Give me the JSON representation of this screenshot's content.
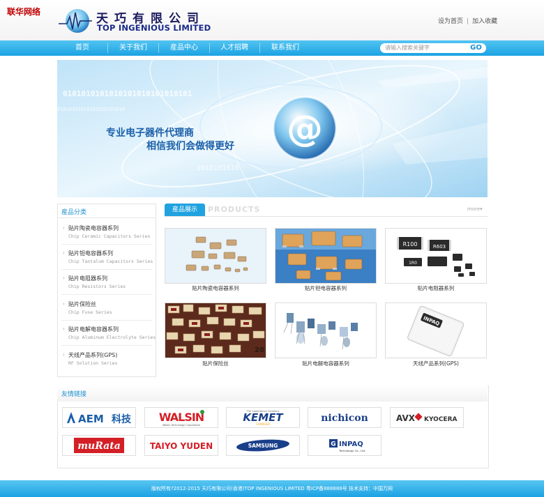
{
  "watermark": "联华网络",
  "brand": {
    "cn": "天巧有限公司",
    "en": "TOP INGENIOUS LIMITED"
  },
  "top_links": {
    "home": "设为首页",
    "separator": "|",
    "favorite": "加入收藏"
  },
  "nav": {
    "items": [
      {
        "label": "首页"
      },
      {
        "label": "关于我们"
      },
      {
        "label": "産品中心"
      },
      {
        "label": "人才招聘"
      },
      {
        "label": "联系我们"
      }
    ],
    "search_placeholder": "请输入搜索关键字",
    "search_button": "GO"
  },
  "banner": {
    "line1": "专业电子器件代理商",
    "line2": "相信我们会做得更好",
    "binary_top": "0101010101010101010101010101",
    "binary_mid": "01010101010101010101010",
    "binary_small": "1010101010",
    "at_symbol": "@"
  },
  "sidebar": {
    "title": "産品分类",
    "categories": [
      {
        "cn": "贴片陶瓷电容器系列",
        "en": "Chip Ceramic Capacitors Series"
      },
      {
        "cn": "贴片钽电容器系列",
        "en": "Chip Tantalum Capacitors Series"
      },
      {
        "cn": "贴片电阻器系列",
        "en": "Chip Resistors Series"
      },
      {
        "cn": "贴片保险丝",
        "en": "Chip Fuse Series"
      },
      {
        "cn": "贴片电解电容器系列",
        "en": "Chip Aluminum Electrolyte Series"
      },
      {
        "cn": "天线产品系列(GPS)",
        "en": "RF Solution Series"
      }
    ]
  },
  "products": {
    "tab": "産品展示",
    "tab_en": "PRODUCTS",
    "more": "more",
    "items": [
      {
        "caption": "贴片陶瓷电容器系列"
      },
      {
        "caption": "贴片钽电容器系列"
      },
      {
        "caption": "贴片电阻器系列"
      },
      {
        "caption": "贴片保险丝"
      },
      {
        "caption": "贴片电解电容器系列"
      },
      {
        "caption": "天线产品系列(GPS)"
      }
    ]
  },
  "friend_links": {
    "title": "友情链接",
    "brands": [
      {
        "name": "AEM",
        "suffix": "科技"
      },
      {
        "name": "WALSIN",
        "sub": "Walsin Technology Corporation"
      },
      {
        "name": "KEMET",
        "top": "The Capacitance Company",
        "sub": "CHARGED"
      },
      {
        "name": "nichicon"
      },
      {
        "name": "AVX",
        "suffix": "KYOCERA"
      },
      {
        "name": "muRata"
      },
      {
        "name": "TAIYO YUDEN"
      },
      {
        "name": "SAMSUNG"
      },
      {
        "name": "INPAQ",
        "sub": "Technology Co., Ltd."
      }
    ]
  },
  "component_labels": {
    "r100": "R100",
    "r603": "R603",
    "n1": "1R0",
    "inpaq": "INPAQ",
    "fuse": "20"
  },
  "footer": {
    "text": "版权所有?2012-2015 天巧有限公司(香港)TOP INGENIOUS LIMITED 粤ICP备888888号 技术支持：中国万网"
  },
  "colors": {
    "accent": "#1ca3e3",
    "nav_top": "#52c4f1",
    "brand_navy": "#1a1a5e",
    "watermark": "#c00000"
  }
}
